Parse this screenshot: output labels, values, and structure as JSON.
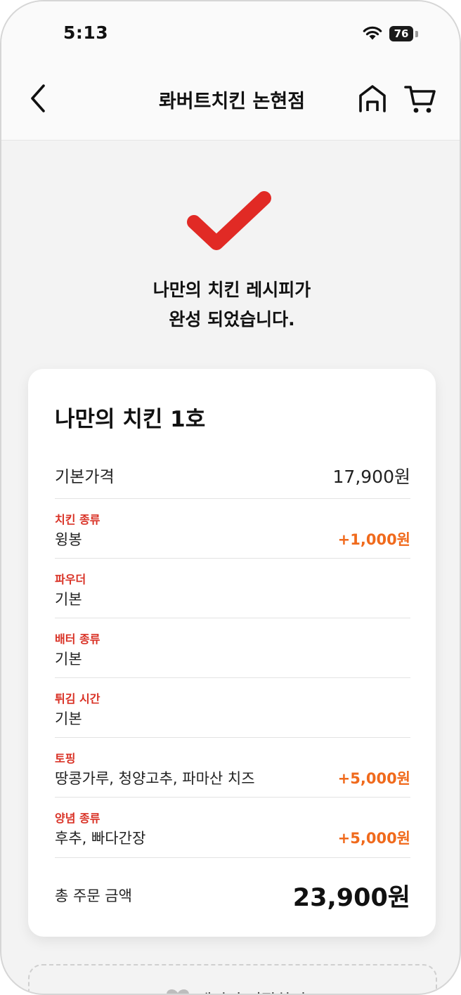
{
  "status_bar": {
    "time": "5:13",
    "battery": "76"
  },
  "header": {
    "title": "롸버트치킨 논현점"
  },
  "complete_message": {
    "line1": "나만의 치킨 레시피가",
    "line2": "완성 되었습니다."
  },
  "colors": {
    "accent_red": "#e12a25",
    "category_red": "#d93125",
    "price_orange": "#f06a1c"
  },
  "card": {
    "recipe_name": "나만의 치킨 1호",
    "base": {
      "label": "기본가격",
      "price": "17,900원"
    },
    "options": [
      {
        "category": "치킨 종류",
        "value": "윙봉",
        "price": "+1,000원"
      },
      {
        "category": "파우더",
        "value": "기본",
        "price": ""
      },
      {
        "category": "배터 종류",
        "value": "기본",
        "price": ""
      },
      {
        "category": "튀김 시간",
        "value": "기본",
        "price": ""
      },
      {
        "category": "토핑",
        "value": "땅콩가루, 청양고추, 파마산 치즈",
        "price": "+5,000원"
      },
      {
        "category": "양념 종류",
        "value": "후추, 빠다간장",
        "price": "+5,000원"
      }
    ],
    "total": {
      "label": "총 주문 금액",
      "price": "23,900원"
    }
  },
  "save_button": {
    "label": "레시피 저장하기"
  },
  "icons": {
    "back": "chevron-left-icon",
    "home": "home-icon",
    "cart": "cart-icon",
    "check": "checkmark-icon",
    "heart": "heart-icon",
    "wifi": "wifi-icon"
  }
}
